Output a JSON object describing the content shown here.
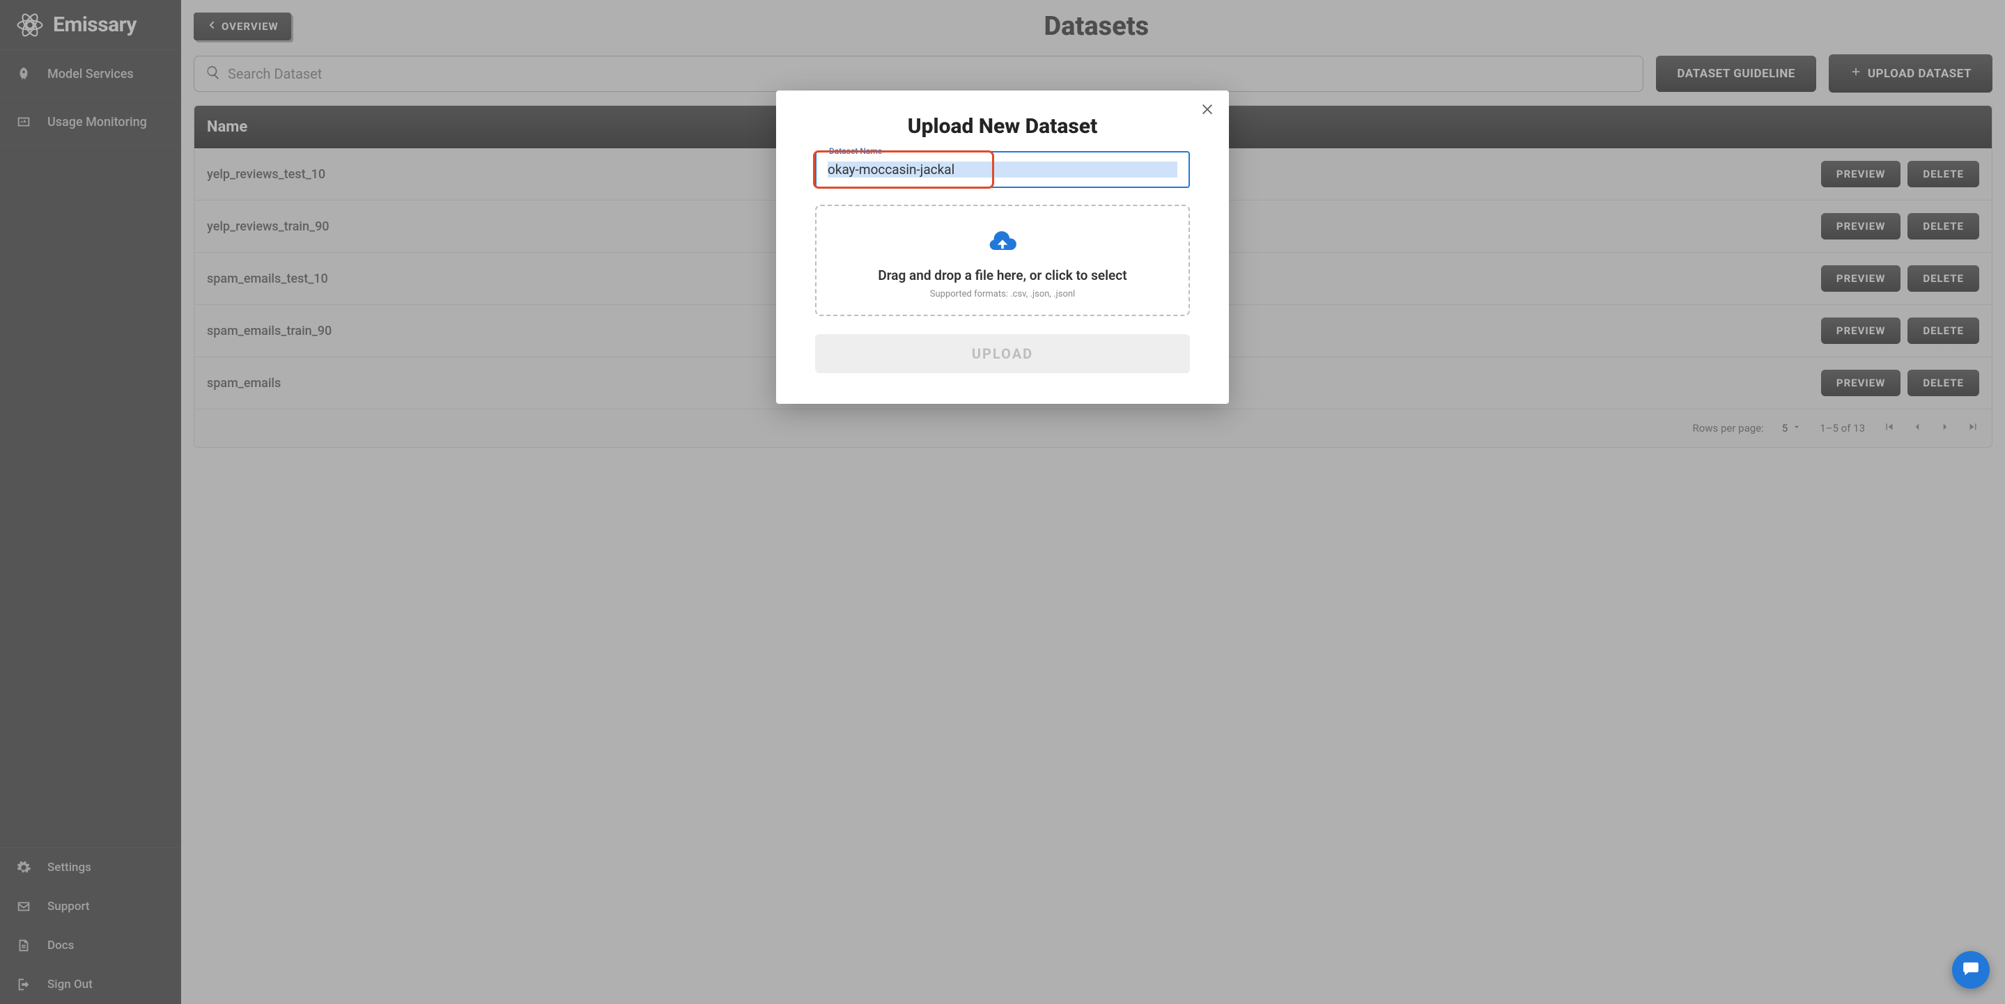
{
  "brand": {
    "name": "Emissary"
  },
  "sidebar": {
    "nav": [
      {
        "label": "Model Services"
      },
      {
        "label": "Usage Monitoring"
      }
    ],
    "bottom": [
      {
        "label": "Settings"
      },
      {
        "label": "Support"
      },
      {
        "label": "Docs"
      },
      {
        "label": "Sign Out"
      }
    ]
  },
  "header": {
    "overview_label": "OVERVIEW",
    "page_title": "Datasets"
  },
  "search": {
    "placeholder": "Search Dataset"
  },
  "buttons": {
    "guideline": "DATASET GUIDELINE",
    "upload": "UPLOAD DATASET",
    "preview": "PREVIEW",
    "delete": "DELETE"
  },
  "table": {
    "header_name": "Name",
    "rows": [
      {
        "name": "yelp_reviews_test_10"
      },
      {
        "name": "yelp_reviews_train_90"
      },
      {
        "name": "spam_emails_test_10"
      },
      {
        "name": "spam_emails_train_90"
      },
      {
        "name": "spam_emails"
      }
    ],
    "footer": {
      "rows_label": "Rows per page:",
      "rows_value": "5",
      "range": "1–5 of 13"
    }
  },
  "modal": {
    "title": "Upload New Dataset",
    "field_label": "Dataset Name",
    "field_value": "okay-moccasin-jackal",
    "drop_text": "Drag and drop a file here, or click to select",
    "drop_sub": "Supported formats: .csv, .json, .jsonl",
    "upload_label": "UPLOAD"
  }
}
